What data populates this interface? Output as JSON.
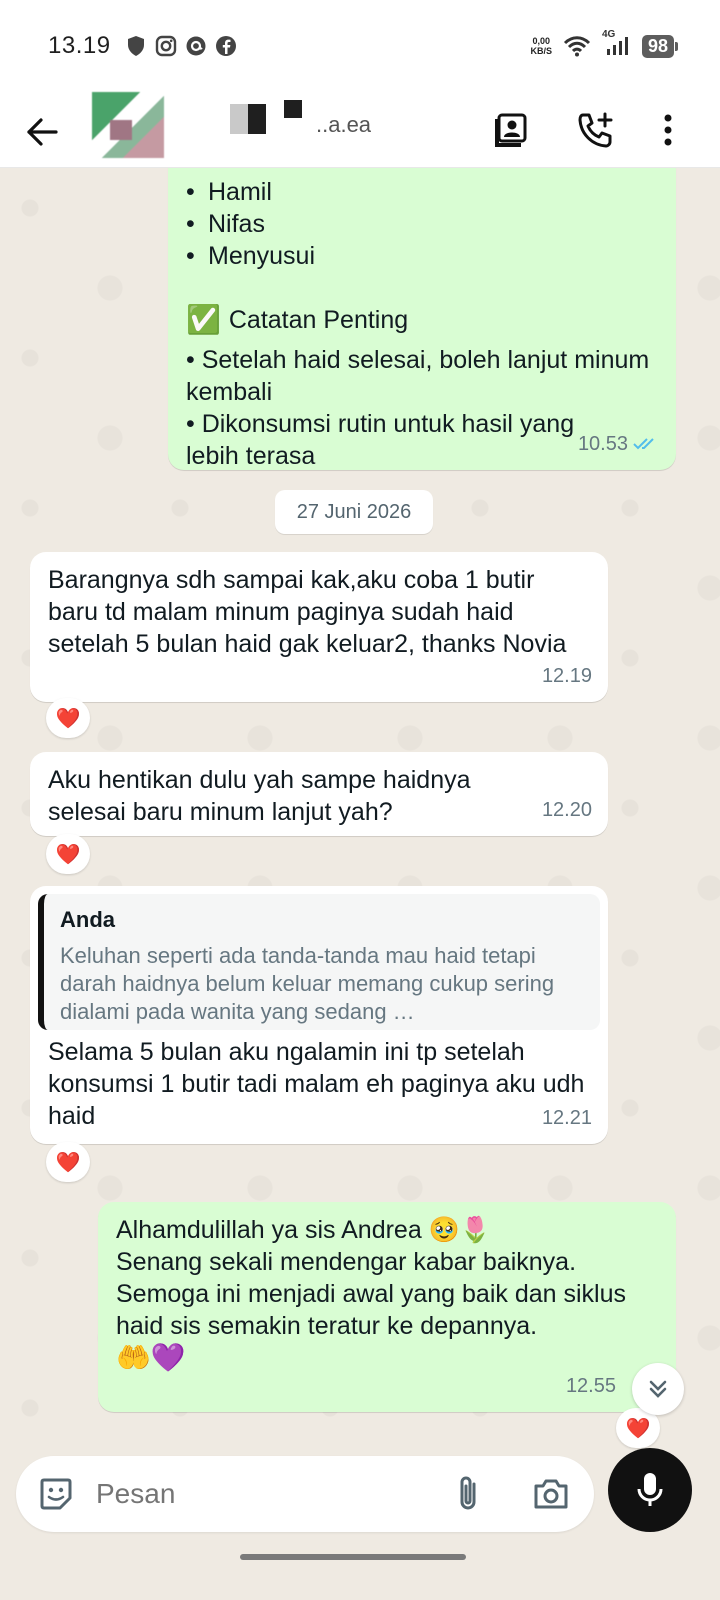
{
  "status_bar": {
    "time": "13.19",
    "net_speed_value": "0,00",
    "net_speed_unit": "KB/S",
    "network_type": "4G",
    "battery": "98"
  },
  "header": {
    "contact_name_fragment": "..a.ea",
    "icons": [
      "back-arrow",
      "avatar",
      "video-call",
      "add-call",
      "more-options"
    ]
  },
  "messages": {
    "top_outgoing": {
      "bullets": [
        "Hamil",
        "Nifas",
        "Menyusui"
      ],
      "section_emoji": "✅",
      "section_title": "Catatan Penting",
      "notes": [
        "Setelah haid selesai, boleh lanjut minum kembali",
        "Dikonsumsi rutin untuk hasil yang lebih terasa"
      ],
      "time": "10.53"
    },
    "date_chip": "27 Juni 2026",
    "msg1": {
      "text": "Barangnya sdh sampai kak,aku coba 1 butir baru td malam minum paginya sudah  haid setelah 5 bulan haid gak keluar2, thanks Novia",
      "time": "12.19",
      "reaction": "❤️"
    },
    "msg2": {
      "text": "Aku hentikan dulu yah sampe haidnya selesai baru minum lanjut yah?",
      "time": "12.20",
      "reaction": "❤️"
    },
    "msg3": {
      "quote_author": "Anda",
      "quote_text": "Keluhan seperti ada tanda-tanda mau haid tetapi darah haidnya belum keluar memang cukup sering dialami pada wanita yang sedang …",
      "text": "Selama 5 bulan aku ngalamin ini tp setelah konsumsi 1 butir tadi malam eh paginya aku udh haid",
      "time": "12.21",
      "reaction": "❤️"
    },
    "msg4": {
      "line1": "Alhamdulillah ya sis Andrea 🥹🌷",
      "line2": "Senang sekali mendengar kabar baiknya. Semoga ini menjadi awal yang baik dan siklus haid sis semakin teratur ke depannya.",
      "emojis": "🤲💜",
      "time": "12.55",
      "reaction": "❤️"
    }
  },
  "composer": {
    "placeholder": "Pesan"
  },
  "colors": {
    "outgoing_bubble": "#d9fdd3",
    "incoming_bubble": "#ffffff",
    "chat_background": "#efeae2",
    "read_ticks": "#53bdeb"
  }
}
